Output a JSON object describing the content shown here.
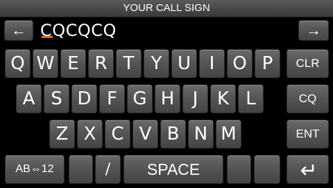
{
  "title": "YOUR CALL SIGN",
  "entry_text": "CQCQCQ",
  "nav": {
    "left_arrow": "←",
    "right_arrow": "→"
  },
  "rows": {
    "row1": [
      "Q",
      "W",
      "E",
      "R",
      "T",
      "Y",
      "U",
      "I",
      "O",
      "P"
    ],
    "row2": [
      "A",
      "S",
      "D",
      "F",
      "G",
      "H",
      "J",
      "K",
      "L"
    ],
    "row3": [
      "Z",
      "X",
      "C",
      "V",
      "B",
      "N",
      "M"
    ]
  },
  "side": {
    "clr": "CLR",
    "cq": "CQ",
    "ent": "ENT"
  },
  "bottom": {
    "mode": "AB⇔12",
    "slash": "/",
    "space": "SPACE"
  },
  "colors": {
    "cursor": "#e06a1a",
    "key": "#555555",
    "background": "#000000"
  }
}
